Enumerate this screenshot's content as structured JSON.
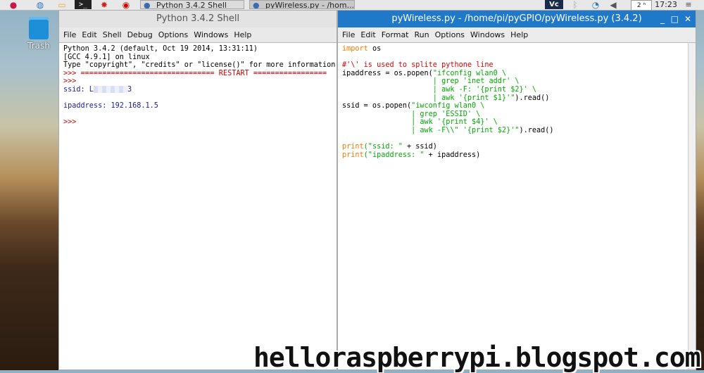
{
  "taskbar": {
    "tasks": [
      {
        "label": "Python 3.4.2 Shell"
      },
      {
        "label": "pyWireless.py - /hom..."
      }
    ],
    "tray": {
      "keyboard": "2 ⁿ",
      "clock": "17:23"
    }
  },
  "desktop": {
    "trash_label": "Trash"
  },
  "shell": {
    "title": "Python 3.4.2 Shell",
    "menu": [
      "File",
      "Edit",
      "Shell",
      "Debug",
      "Options",
      "Windows",
      "Help"
    ],
    "lines": {
      "l1": "Python 3.4.2 (default, Oct 19 2014, 13:31:11)",
      "l2": "[GCC 4.9.1] on linux",
      "l3": "Type \"copyright\", \"credits\" or \"license()\" for more information",
      "l4": ">>> =============================== RESTART =================",
      "l5": ">>>",
      "ssid_prefix": "ssid: L",
      "ssid_suffix": "3",
      "ipaddr": "ipaddress: 192.168.1.5",
      "prompt": ">>>"
    }
  },
  "editor": {
    "title": "pyWireless.py - /home/pi/pyGPIO/pyWireless.py (3.4.2)",
    "menu": [
      "File",
      "Edit",
      "Format",
      "Run",
      "Options",
      "Windows",
      "Help"
    ],
    "code": {
      "c1_kw": "import",
      "c1_rest": " os",
      "c2": "#'\\' is used to splite pythone line",
      "c3_pre": "ipaddress = os.popen(",
      "c3_str": "\"ifconfig wlan0 \\",
      "c4": "                     | grep 'inet addr' \\",
      "c5": "                     | awk -F: '{print $2}' \\",
      "c6_str": "                     | awk '{print $1}'\"",
      "c6_rest": ").read()",
      "c7_pre": "ssid = os.popen(",
      "c7_str": "\"iwconfig wlan0 \\",
      "c8": "                | grep 'ESSID' \\",
      "c9": "                | awk '{print $4}' \\",
      "c10_str": "                | awk -F\\\\\" '{print $2}'\"",
      "c10_rest": ").read()",
      "c11_kw": "print",
      "c11_str": "(\"ssid: \"",
      "c11_rest": " + ssid)",
      "c12_kw": "print",
      "c12_str": "(\"ipaddress: \"",
      "c12_rest": " + ipaddress)"
    }
  },
  "watermark": "helloraspberrypi.blogspot.com",
  "colors": {
    "editor_title_bg": "#1f78c8",
    "keyword": "#ff7700",
    "string": "#00aa00",
    "comment": "#dd0000",
    "output": "#1a1aa6"
  }
}
